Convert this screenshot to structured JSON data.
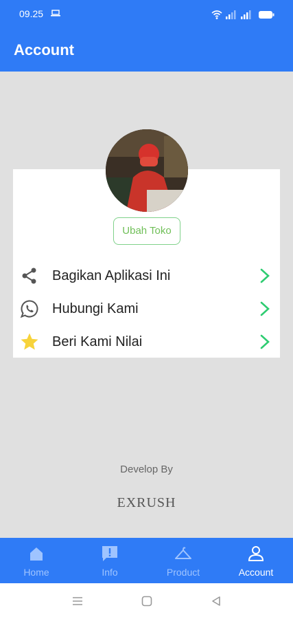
{
  "status_bar": {
    "time": "09.25"
  },
  "app_bar": {
    "title": "Account"
  },
  "store": {
    "change_button": "Ubah Toko"
  },
  "menu": [
    {
      "label": "Bagikan Aplikasi Ini",
      "icon": "share-icon"
    },
    {
      "label": "Hubungi Kami",
      "icon": "whatsapp-icon"
    },
    {
      "label": "Beri Kami Nilai",
      "icon": "star-icon"
    }
  ],
  "footer": {
    "develop_by": "Develop By",
    "brand": "EXRUSH"
  },
  "bottom_nav": [
    {
      "label": "Home",
      "icon": "home-icon"
    },
    {
      "label": "Info",
      "icon": "info-icon"
    },
    {
      "label": "Product",
      "icon": "hanger-icon"
    },
    {
      "label": "Account",
      "icon": "user-icon",
      "active": true
    }
  ],
  "colors": {
    "primary": "#2f7bf6",
    "accent_green": "#2ecc71",
    "star": "#f7d33b"
  }
}
